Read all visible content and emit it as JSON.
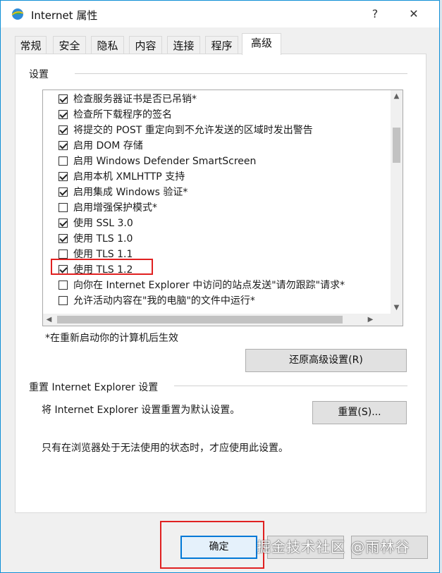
{
  "window": {
    "title": "Internet 属性",
    "help_button": "?",
    "close_button": "✕"
  },
  "tabs": [
    {
      "label": "常规"
    },
    {
      "label": "安全"
    },
    {
      "label": "隐私"
    },
    {
      "label": "内容"
    },
    {
      "label": "连接"
    },
    {
      "label": "程序"
    },
    {
      "label": "高级",
      "active": true
    }
  ],
  "settings": {
    "group_label": "设置",
    "items": [
      {
        "label": "检查服务器证书是否已吊销*",
        "checked": true
      },
      {
        "label": "检查所下载程序的签名",
        "checked": true
      },
      {
        "label": "将提交的 POST 重定向到不允许发送的区域时发出警告",
        "checked": true
      },
      {
        "label": "启用 DOM 存储",
        "checked": true
      },
      {
        "label": "启用 Windows Defender SmartScreen",
        "checked": false
      },
      {
        "label": "启用本机 XMLHTTP 支持",
        "checked": true
      },
      {
        "label": "启用集成 Windows 验证*",
        "checked": true
      },
      {
        "label": "启用增强保护模式*",
        "checked": false
      },
      {
        "label": "使用 SSL 3.0",
        "checked": true
      },
      {
        "label": "使用 TLS 1.0",
        "checked": true
      },
      {
        "label": "使用 TLS 1.1",
        "checked": false
      },
      {
        "label": "使用 TLS 1.2",
        "checked": true
      },
      {
        "label": "向你在 Internet Explorer 中访问的站点发送\"请勿跟踪\"请求*",
        "checked": false
      },
      {
        "label": "允许活动内容在\"我的电脑\"的文件中运行*",
        "checked": false
      }
    ],
    "restart_note": "*在重新启动你的计算机后生效",
    "restore_button": "还原高级设置(R)"
  },
  "reset": {
    "group_label": "重置 Internet Explorer 设置",
    "description": "将 Internet Explorer 设置重置为默认设置。",
    "reset_button": "重置(S)...",
    "warning": "只有在浏览器处于无法使用的状态时，才应使用此设置。"
  },
  "footer": {
    "ok_button": "确定"
  },
  "watermark": "掘金技术社区 @雨林谷",
  "colors": {
    "accent": "#0078d7",
    "highlight": "#e02020",
    "window_border": "#0f8fd6"
  }
}
